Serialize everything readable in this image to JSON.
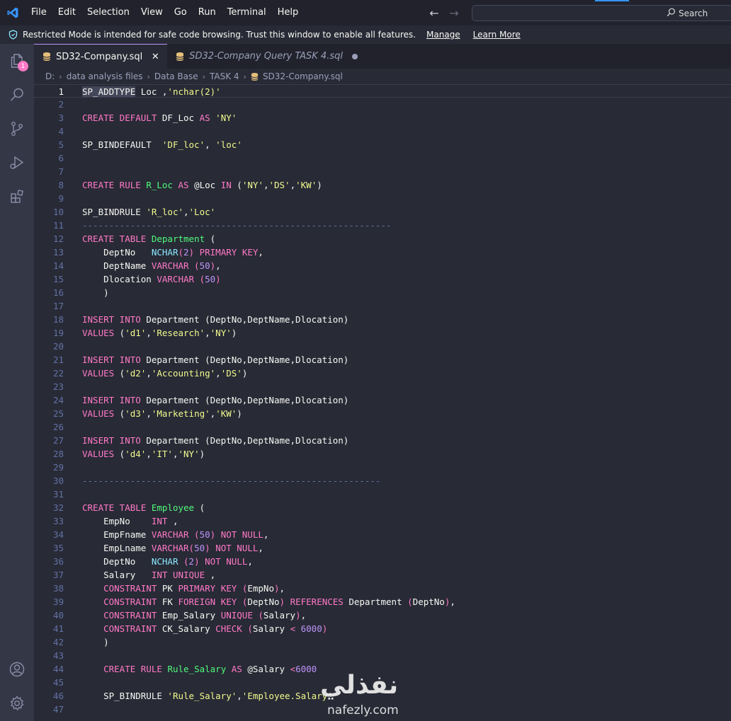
{
  "menu": [
    "File",
    "Edit",
    "Selection",
    "View",
    "Go",
    "Run",
    "Terminal",
    "Help"
  ],
  "search": {
    "label": "Search"
  },
  "banner": {
    "message": "Restricted Mode is intended for safe code browsing. Trust this window to enable all features.",
    "manage": "Manage",
    "learn_more": "Learn More"
  },
  "activity": {
    "badge": "1"
  },
  "tabs": [
    {
      "label": "SD32-Company.sql",
      "active": true
    },
    {
      "label": "SD32-Company Query TASK 4.sql",
      "active": false
    }
  ],
  "breadcrumb": [
    "D:",
    "data analysis files",
    "Data Base",
    "TASK 4",
    "SD32-Company.sql"
  ],
  "colors": {
    "keyword": "#ff79c6",
    "string": "#f1fa8c",
    "function": "#50fa7b",
    "type": "#8be9fd",
    "number": "#bd93f9",
    "comment": "#6272a4",
    "text": "#f8f8f2",
    "background": "#282a36",
    "accent": "#bd93f9"
  },
  "editor": {
    "current_line": 1,
    "lines": [
      [
        [
          "hl",
          "SP_ADDTYPE"
        ],
        [
          "plain",
          " Loc ,"
        ],
        [
          "str",
          "'nchar(2)'"
        ]
      ],
      [],
      [
        [
          "kw",
          "CREATE DEFAULT"
        ],
        [
          "plain",
          " DF_Loc "
        ],
        [
          "kw",
          "AS"
        ],
        [
          "plain",
          " "
        ],
        [
          "str",
          "'NY'"
        ]
      ],
      [],
      [
        [
          "plain",
          "SP_BINDEFAULT  "
        ],
        [
          "str",
          "'DF_loc'"
        ],
        [
          "plain",
          ", "
        ],
        [
          "str",
          "'loc'"
        ]
      ],
      [],
      [],
      [
        [
          "kw",
          "CREATE RULE"
        ],
        [
          "plain",
          " "
        ],
        [
          "fn",
          "R_Loc"
        ],
        [
          "plain",
          " "
        ],
        [
          "kw",
          "AS"
        ],
        [
          "plain",
          " @Loc "
        ],
        [
          "kw",
          "IN"
        ],
        [
          "plain",
          " ("
        ],
        [
          "str",
          "'NY'"
        ],
        [
          "plain",
          ","
        ],
        [
          "str",
          "'DS'"
        ],
        [
          "plain",
          ","
        ],
        [
          "str",
          "'KW'"
        ],
        [
          "plain",
          ")"
        ]
      ],
      [],
      [
        [
          "plain",
          "SP_BINDRULE "
        ],
        [
          "str",
          "'R_loc'"
        ],
        [
          "plain",
          ","
        ],
        [
          "str",
          "'Loc'"
        ]
      ],
      [
        [
          "cmt",
          "----------------------------------------------------------"
        ]
      ],
      [
        [
          "kw",
          "CREATE TABLE"
        ],
        [
          "plain",
          " "
        ],
        [
          "fn",
          "Department"
        ],
        [
          "plain",
          " ("
        ]
      ],
      [
        [
          "plain",
          "    DeptNo   "
        ],
        [
          "type",
          "NCHAR"
        ],
        [
          "kw",
          "("
        ],
        [
          "num",
          "2"
        ],
        [
          "kw",
          ")"
        ],
        [
          "plain",
          " "
        ],
        [
          "kw",
          "PRIMARY KEY"
        ],
        [
          "plain",
          ","
        ]
      ],
      [
        [
          "plain",
          "    DeptName "
        ],
        [
          "kw",
          "VARCHAR ("
        ],
        [
          "num",
          "50"
        ],
        [
          "kw",
          ")"
        ],
        [
          "plain",
          ","
        ]
      ],
      [
        [
          "plain",
          "    Dlocation "
        ],
        [
          "kw",
          "VARCHAR ("
        ],
        [
          "num",
          "50"
        ],
        [
          "kw",
          ")"
        ]
      ],
      [
        [
          "plain",
          "    )"
        ]
      ],
      [],
      [
        [
          "kw",
          "INSERT INTO"
        ],
        [
          "plain",
          " Department (DeptNo,DeptName,Dlocation)"
        ]
      ],
      [
        [
          "kw",
          "VALUES"
        ],
        [
          "plain",
          " ("
        ],
        [
          "str",
          "'d1'"
        ],
        [
          "plain",
          ","
        ],
        [
          "str",
          "'Research'"
        ],
        [
          "plain",
          ","
        ],
        [
          "str",
          "'NY'"
        ],
        [
          "plain",
          ")"
        ]
      ],
      [],
      [
        [
          "kw",
          "INSERT INTO"
        ],
        [
          "plain",
          " Department (DeptNo,DeptName,Dlocation)"
        ]
      ],
      [
        [
          "kw",
          "VALUES"
        ],
        [
          "plain",
          " ("
        ],
        [
          "str",
          "'d2'"
        ],
        [
          "plain",
          ","
        ],
        [
          "str",
          "'Accounting'"
        ],
        [
          "plain",
          ","
        ],
        [
          "str",
          "'DS'"
        ],
        [
          "plain",
          ")"
        ]
      ],
      [],
      [
        [
          "kw",
          "INSERT INTO"
        ],
        [
          "plain",
          " Department (DeptNo,DeptName,Dlocation)"
        ]
      ],
      [
        [
          "kw",
          "VALUES"
        ],
        [
          "plain",
          " ("
        ],
        [
          "str",
          "'d3'"
        ],
        [
          "plain",
          ","
        ],
        [
          "str",
          "'Marketing'"
        ],
        [
          "plain",
          ","
        ],
        [
          "str",
          "'KW'"
        ],
        [
          "plain",
          ")"
        ]
      ],
      [],
      [
        [
          "kw",
          "INSERT INTO"
        ],
        [
          "plain",
          " Department (DeptNo,DeptName,Dlocation)"
        ]
      ],
      [
        [
          "kw",
          "VALUES"
        ],
        [
          "plain",
          " ("
        ],
        [
          "str",
          "'d4'"
        ],
        [
          "plain",
          ","
        ],
        [
          "str",
          "'IT'"
        ],
        [
          "plain",
          ","
        ],
        [
          "str",
          "'NY'"
        ],
        [
          "plain",
          ")"
        ]
      ],
      [],
      [
        [
          "cmt",
          "--------------------------------------------------------"
        ]
      ],
      [],
      [
        [
          "kw",
          "CREATE TABLE"
        ],
        [
          "plain",
          " "
        ],
        [
          "fn",
          "Employee"
        ],
        [
          "plain",
          " ("
        ]
      ],
      [
        [
          "plain",
          "    EmpNo    "
        ],
        [
          "kw",
          "INT"
        ],
        [
          "plain",
          " ,"
        ]
      ],
      [
        [
          "plain",
          "    EmpFname "
        ],
        [
          "kw",
          "VARCHAR ("
        ],
        [
          "num",
          "50"
        ],
        [
          "kw",
          ")"
        ],
        [
          "plain",
          " "
        ],
        [
          "kw",
          "NOT NULL"
        ],
        [
          "plain",
          ","
        ]
      ],
      [
        [
          "plain",
          "    EmpLname "
        ],
        [
          "kw",
          "VARCHAR("
        ],
        [
          "num",
          "50"
        ],
        [
          "kw",
          ")"
        ],
        [
          "plain",
          " "
        ],
        [
          "kw",
          "NOT NULL"
        ],
        [
          "plain",
          ","
        ]
      ],
      [
        [
          "plain",
          "    DeptNo   "
        ],
        [
          "type",
          "NCHAR"
        ],
        [
          "plain",
          " "
        ],
        [
          "kw",
          "("
        ],
        [
          "num",
          "2"
        ],
        [
          "kw",
          ")"
        ],
        [
          "plain",
          " "
        ],
        [
          "kw",
          "NOT NULL"
        ],
        [
          "plain",
          ","
        ]
      ],
      [
        [
          "plain",
          "    Salary   "
        ],
        [
          "kw",
          "INT UNIQUE"
        ],
        [
          "plain",
          " ,"
        ]
      ],
      [
        [
          "plain",
          "    "
        ],
        [
          "kw",
          "CONSTRAINT"
        ],
        [
          "plain",
          " PK "
        ],
        [
          "kw",
          "PRIMARY KEY"
        ],
        [
          "plain",
          " "
        ],
        [
          "kw",
          "("
        ],
        [
          "plain",
          "EmpNo"
        ],
        [
          "kw",
          ")"
        ],
        [
          "plain",
          ","
        ]
      ],
      [
        [
          "plain",
          "    "
        ],
        [
          "kw",
          "CONSTRAINT"
        ],
        [
          "plain",
          " FK "
        ],
        [
          "kw",
          "FOREIGN KEY"
        ],
        [
          "plain",
          " "
        ],
        [
          "kw",
          "("
        ],
        [
          "plain",
          "DeptNo"
        ],
        [
          "kw",
          ")"
        ],
        [
          "plain",
          " "
        ],
        [
          "kw",
          "REFERENCES"
        ],
        [
          "plain",
          " Department "
        ],
        [
          "kw",
          "("
        ],
        [
          "plain",
          "DeptNo"
        ],
        [
          "kw",
          ")"
        ],
        [
          "plain",
          ","
        ]
      ],
      [
        [
          "plain",
          "    "
        ],
        [
          "kw",
          "CONSTRAINT"
        ],
        [
          "plain",
          " Emp_Salary "
        ],
        [
          "kw",
          "UNIQUE"
        ],
        [
          "plain",
          " "
        ],
        [
          "kw",
          "("
        ],
        [
          "plain",
          "Salary"
        ],
        [
          "kw",
          ")"
        ],
        [
          "plain",
          ","
        ]
      ],
      [
        [
          "plain",
          "    "
        ],
        [
          "kw",
          "CONSTRAINT"
        ],
        [
          "plain",
          " CK_Salary "
        ],
        [
          "kw",
          "CHECK"
        ],
        [
          "plain",
          " "
        ],
        [
          "kw",
          "("
        ],
        [
          "plain",
          "Salary "
        ],
        [
          "kw",
          "<"
        ],
        [
          "plain",
          " "
        ],
        [
          "num",
          "6000"
        ],
        [
          "kw",
          ")"
        ]
      ],
      [
        [
          "plain",
          "    )"
        ]
      ],
      [],
      [
        [
          "plain",
          "    "
        ],
        [
          "kw",
          "CREATE RULE"
        ],
        [
          "plain",
          " "
        ],
        [
          "fn",
          "Rule_Salary"
        ],
        [
          "plain",
          " "
        ],
        [
          "kw",
          "AS"
        ],
        [
          "plain",
          " @Salary "
        ],
        [
          "kw",
          "<"
        ],
        [
          "num",
          "6000"
        ]
      ],
      [],
      [
        [
          "plain",
          "    SP_BINDRULE "
        ],
        [
          "str",
          "'Rule_Salary'"
        ],
        [
          "plain",
          ","
        ],
        [
          "str",
          "'Employee.Salary'"
        ]
      ],
      []
    ]
  },
  "watermark": {
    "arabic": "نفذلي",
    "latin": "nafezly.com"
  }
}
